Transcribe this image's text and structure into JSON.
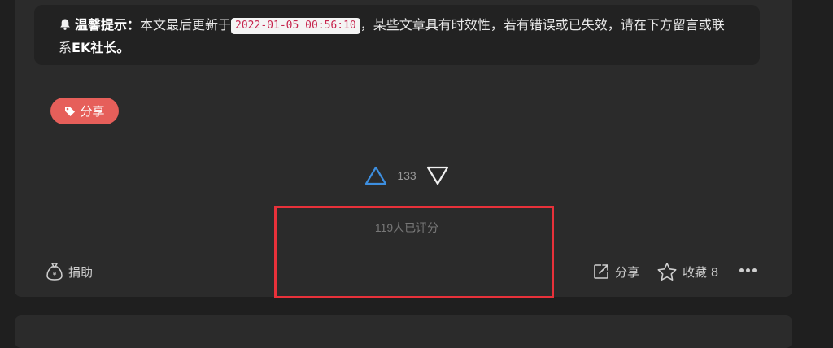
{
  "notice": {
    "label": "温馨提示：",
    "text_before": "本文最后更新于",
    "updated_at": "2022-01-05 00:56:10",
    "text_after": "，某些文章具有时效性，若有错误或已失效，请在下方留言或联系",
    "contact": "EK社长",
    "end": "。"
  },
  "tag": {
    "label": "分享"
  },
  "vote": {
    "count": "133",
    "rated_text": "119人已评分"
  },
  "footer": {
    "donate_label": "捐助",
    "share_label": "分享",
    "favorite_label": "收藏 8"
  },
  "colors": {
    "tag_bg": "#e65f5a",
    "upvote": "#3d8fe0",
    "highlight": "#e8313a"
  }
}
